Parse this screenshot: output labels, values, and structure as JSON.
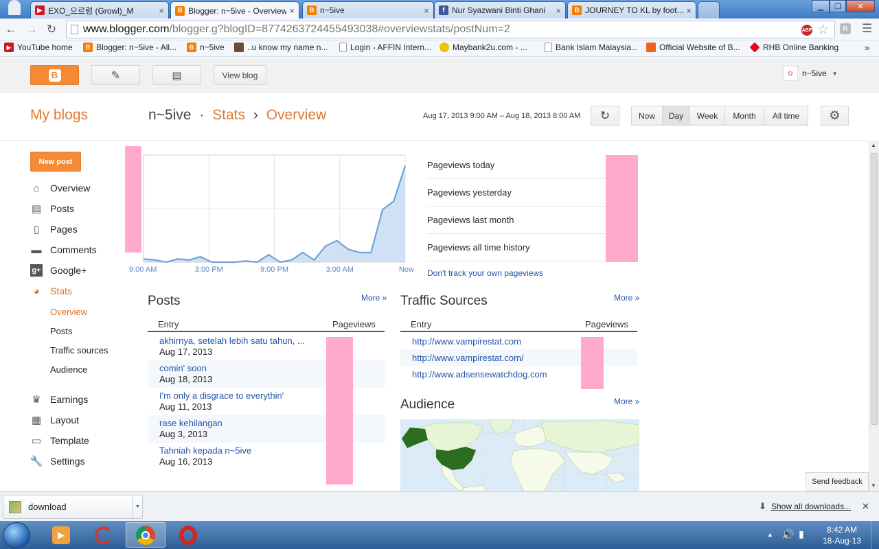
{
  "browser": {
    "tabs": [
      {
        "label": "EXO_으르렁 (Growl)_M",
        "favicon": "youtube-icon",
        "color": "#cc181e"
      },
      {
        "label": "Blogger: n~5ive - Overview",
        "favicon": "blogger-icon",
        "color": "#f57d00",
        "active": true
      },
      {
        "label": "n~5ive",
        "favicon": "blogger-icon",
        "color": "#f57d00"
      },
      {
        "label": "Nur Syazwani Binti Ghani",
        "favicon": "facebook-icon",
        "color": "#3b5998"
      },
      {
        "label": "JOURNEY TO KL by foot...",
        "favicon": "blogger-icon",
        "color": "#f57d00"
      }
    ],
    "url_host": "www.blogger.com",
    "url_rest": "/blogger.g?blogID=8774263724455493038#overviewstats/postNum=2",
    "bookmarks": [
      {
        "label": "YouTube home",
        "icon": "youtube-icon"
      },
      {
        "label": "Blogger: n~5ive - All...",
        "icon": "blogger-icon"
      },
      {
        "label": "n~5ive",
        "icon": "blogger-icon"
      },
      {
        "label": "..u know my name n...",
        "icon": "image-icon"
      },
      {
        "label": "Login - AFFIN Intern...",
        "icon": "page-icon"
      },
      {
        "label": "Maybank2u.com - ...",
        "icon": "maybank-icon"
      },
      {
        "label": "Bank Islam Malaysia...",
        "icon": "page-icon"
      },
      {
        "label": "Official Website of B...",
        "icon": "bsn-icon"
      },
      {
        "label": "RHB Online Banking",
        "icon": "rhb-icon"
      }
    ]
  },
  "blogger": {
    "view_blog": "View blog",
    "user": "n~5ive",
    "my_blogs": "My blogs",
    "crumb_blog": "n~5ive",
    "crumb_sep1": "·",
    "crumb_stats": "Stats",
    "crumb_sep2": "›",
    "crumb_page": "Overview",
    "date_range": "Aug 17, 2013 9:00 AM – Aug 18, 2013 8:00 AM",
    "ranges": [
      "Now",
      "Day",
      "Week",
      "Month",
      "All time"
    ],
    "selected_range": "Day",
    "new_post": "New post",
    "nav": [
      {
        "label": "Overview",
        "icon": "home-icon"
      },
      {
        "label": "Posts",
        "icon": "posts-icon"
      },
      {
        "label": "Pages",
        "icon": "pages-icon"
      },
      {
        "label": "Comments",
        "icon": "comments-icon"
      },
      {
        "label": "Google+",
        "icon": "googleplus-icon"
      },
      {
        "label": "Stats",
        "icon": "stats-icon",
        "active": true
      }
    ],
    "stats_sub": [
      "Overview",
      "Posts",
      "Traffic sources",
      "Audience"
    ],
    "nav2": [
      {
        "label": "Earnings",
        "icon": "trophy-icon"
      },
      {
        "label": "Layout",
        "icon": "layout-icon"
      },
      {
        "label": "Template",
        "icon": "template-icon"
      },
      {
        "label": "Settings",
        "icon": "wrench-icon"
      }
    ],
    "pageviews": [
      "Pageviews today",
      "Pageviews yesterday",
      "Pageviews last month",
      "Pageviews all time history"
    ],
    "dont_track": "Don't track your own pageviews",
    "posts_title": "Posts",
    "more": "More »",
    "col_entry": "Entry",
    "col_pageviews": "Pageviews",
    "posts": [
      {
        "title": "akhirnya, setelah lebih satu tahun, ...",
        "date": "Aug 17, 2013"
      },
      {
        "title": "comin' soon",
        "date": "Aug 18, 2013"
      },
      {
        "title": "I'm only a disgrace to everythin'",
        "date": "Aug 11, 2013"
      },
      {
        "title": "rase kehilangan",
        "date": "Aug 3, 2013"
      },
      {
        "title": "Tahniah kepada n~5ive",
        "date": "Aug 16, 2013"
      }
    ],
    "traffic_title": "Traffic Sources",
    "traffic": [
      "http://www.vampirestat.com",
      "http://www.vampirestat.com/",
      "http://www.adsensewatchdog.com"
    ],
    "audience_title": "Audience",
    "send_feedback": "Send feedback"
  },
  "chart_data": {
    "type": "area",
    "x_tick_labels": [
      "9:00 AM",
      "3:00 PM",
      "9:00 PM",
      "3:00 AM",
      "Now"
    ],
    "values_relative": [
      0.03,
      0.02,
      0.0,
      0.03,
      0.02,
      0.05,
      0.0,
      0.0,
      0.0,
      0.01,
      0.0,
      0.07,
      0.0,
      0.02,
      0.09,
      0.02,
      0.15,
      0.2,
      0.12,
      0.09,
      0.09,
      0.49,
      0.57,
      0.9
    ],
    "y_axis_labels_hidden": true,
    "colors": {
      "line": "#6fa1d9",
      "fill": "#c9dcf3"
    }
  },
  "downloads": {
    "file": "download",
    "show_all": "Show all downloads..."
  },
  "taskbar": {
    "time": "8:42 AM",
    "date": "18-Aug-13"
  }
}
